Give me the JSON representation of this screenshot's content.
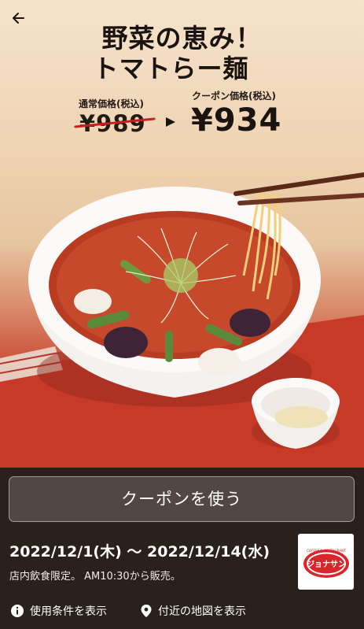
{
  "nav": {
    "back_icon": "arrow-left-icon"
  },
  "promo": {
    "title_line1": "野菜の恵み！",
    "title_line2": "トマトらー麺",
    "regular_label": "通常価格(税込)",
    "regular_price": "¥989",
    "coupon_label": "クーポン価格(税込)",
    "coupon_price": "¥934",
    "accent_color": "#c81e1e"
  },
  "action": {
    "use_coupon_label": "クーポンを使う"
  },
  "validity": {
    "period": "2022/12/1(木) 〜 2022/12/14(水)",
    "note": "店内飲食限定。 AM10:30から販売。"
  },
  "brand": {
    "logo_top_text": "COFFEE & RESTAURANT",
    "logo_name": "ジョナサン",
    "logo_color": "#d8262d"
  },
  "links": {
    "terms_icon": "info-icon",
    "terms_label": "使用条件を表示",
    "map_icon": "location-pin-icon",
    "map_label": "付近の地図を表示"
  }
}
